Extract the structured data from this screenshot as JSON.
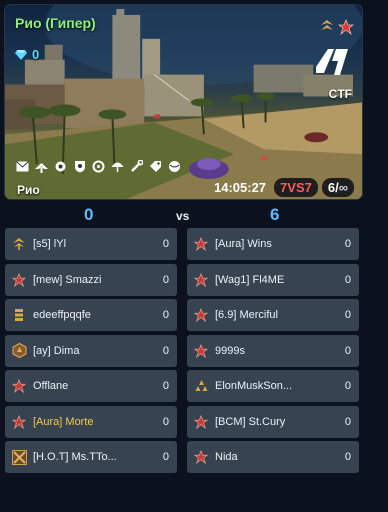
{
  "banner": {
    "battle_name": "Рио (Гипер)",
    "gems": "0",
    "mode": "CTF",
    "map_name": "Рио",
    "timer": "14:05:27",
    "teams_vs": "7VS7",
    "players": "6",
    "players_max": "∞",
    "equipment_icons": [
      "envelope-icon",
      "wings-icon",
      "gear-icon",
      "shield-icon",
      "cycle-icon",
      "umbrella-icon",
      "wrench-icon",
      "tag-icon",
      "globe-icon"
    ]
  },
  "score": {
    "red": "0",
    "vs": "vs",
    "blue": "6"
  },
  "teams": {
    "left": [
      {
        "name": "[s5] lYl",
        "score": "0",
        "rank": "gold-sword-rank",
        "highlight": false
      },
      {
        "name": "[mew] Smazzi",
        "score": "0",
        "rank": "red-star-rank",
        "highlight": false
      },
      {
        "name": "edeeffpqqfe",
        "score": "0",
        "rank": "gold-stripes-rank",
        "highlight": false
      },
      {
        "name": "[ay] Dima",
        "score": "0",
        "rank": "shield-rank",
        "highlight": false
      },
      {
        "name": "Offlane",
        "score": "0",
        "rank": "red-star-rank",
        "highlight": false
      },
      {
        "name": "[Aura] Morte",
        "score": "0",
        "rank": "red-star-rank",
        "highlight": true
      },
      {
        "name": "[H.O.T] Ms.TTo...",
        "score": "0",
        "rank": "crossed-swords-rank",
        "highlight": false
      }
    ],
    "right": [
      {
        "name": "[Aura] Wins",
        "score": "0",
        "rank": "red-star-rank",
        "highlight": false
      },
      {
        "name": "[Wag1] Fl4ME",
        "score": "0",
        "rank": "red-star-rank",
        "highlight": false
      },
      {
        "name": "[6.9] Merciful",
        "score": "0",
        "rank": "red-star-rank",
        "highlight": false
      },
      {
        "name": "9999s",
        "score": "0",
        "rank": "red-star-rank",
        "highlight": false
      },
      {
        "name": "ElonMuskSon...",
        "score": "0",
        "rank": "gold-pyramid-rank",
        "highlight": false
      },
      {
        "name": "[BCM] St.Cury",
        "score": "0",
        "rank": "red-star-rank",
        "highlight": false
      },
      {
        "name": "Nida",
        "score": "0",
        "rank": "red-star-rank",
        "highlight": false
      }
    ]
  },
  "colors": {
    "battle_name": "#8ff07a",
    "score": "#5fb8ff",
    "teams_vs": "#ff5a5a",
    "row_bg": "#384351",
    "highlight_name": "#f2c94c"
  }
}
